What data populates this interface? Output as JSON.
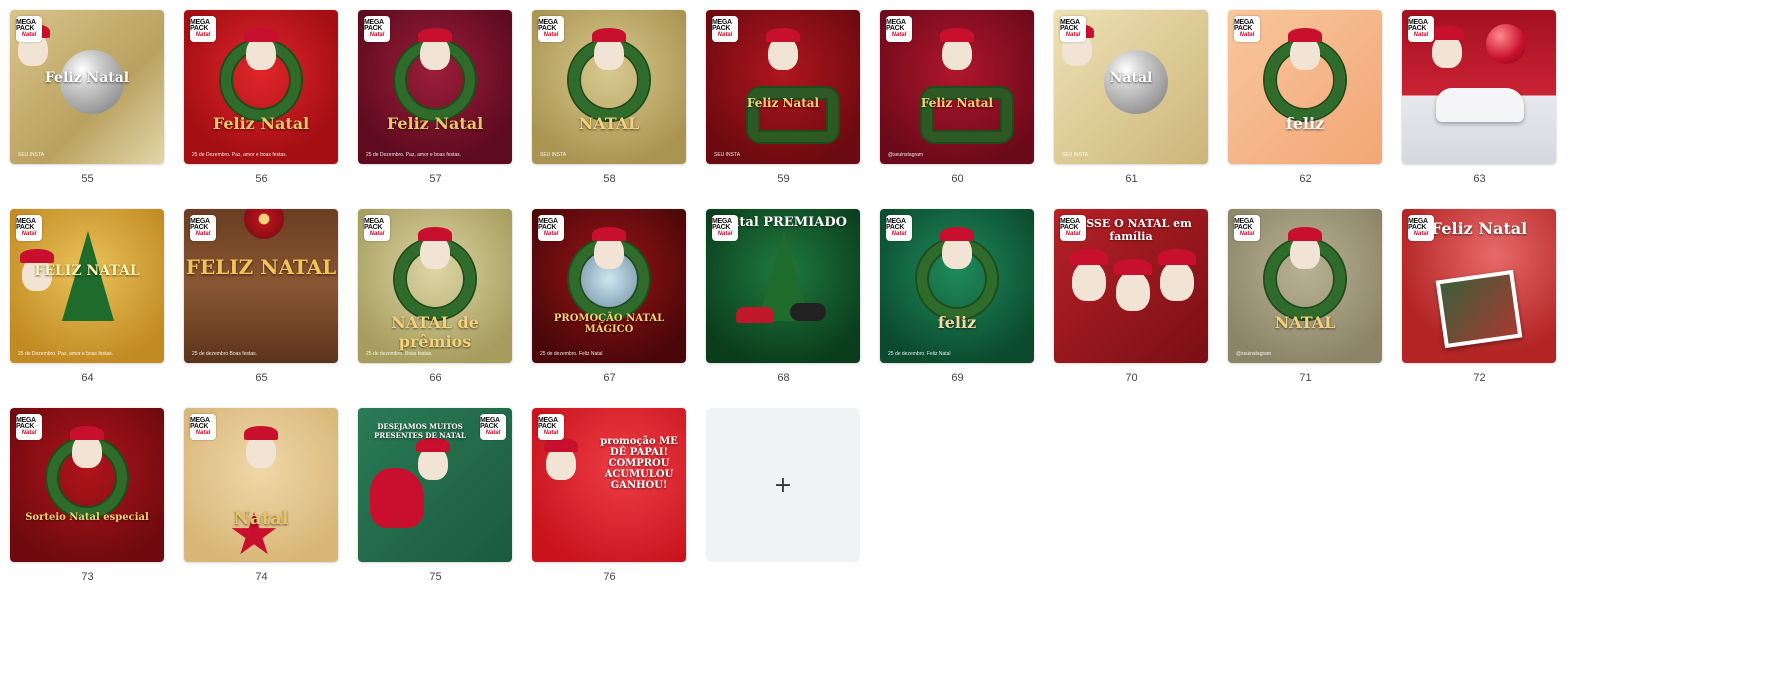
{
  "tiles": [
    {
      "num": "55",
      "bg": "linear-gradient(135deg,#d9c48a,#b9a260 60%,#e3d6a8)",
      "title": "Feliz Natal",
      "titleColor": "#ffffff",
      "caption": "SEU INSTA",
      "motif": "ornament"
    },
    {
      "num": "56",
      "bg": "radial-gradient(circle at 50% 40%,#e0262b,#a50f14 70%)",
      "title": "Feliz Natal",
      "titleColor": "#e8c66a",
      "caption": "25 de Dezembro. Paz, amor e boas festas.",
      "motif": "wreath"
    },
    {
      "num": "57",
      "bg": "radial-gradient(circle at 50% 40%,#9c1d3a,#5e0b1f 75%)",
      "title": "Feliz Natal",
      "titleColor": "#e8c66a",
      "caption": "25 de Dezembro. Paz, amor e boas festas.",
      "motif": "wreath"
    },
    {
      "num": "58",
      "bg": "radial-gradient(circle at 50% 40%,#d8c98f,#a99451 80%)",
      "title": "NATAL",
      "titleColor": "#f3d27a",
      "caption": "SEU INSTA",
      "motif": "wreath"
    },
    {
      "num": "59",
      "bg": "radial-gradient(circle at 50% 40%,#b0161c,#6b0a10 80%)",
      "title": "Feliz Natal",
      "titleColor": "#f1d27b",
      "caption": "SEU INSTA",
      "motif": "frame"
    },
    {
      "num": "60",
      "bg": "radial-gradient(circle at 50% 40%,#b0162c,#6b0a1a 80%)",
      "title": "Feliz Natal",
      "titleColor": "#f1d27b",
      "caption": "@seuinstagram",
      "motif": "frame"
    },
    {
      "num": "61",
      "bg": "linear-gradient(135deg,#efe1b6,#cbb677)",
      "title": "Natal",
      "titleColor": "#ffffff",
      "caption": "SEU INSTA",
      "motif": "ornament"
    },
    {
      "num": "62",
      "bg": "linear-gradient(135deg,#f7c79c,#f3a676)",
      "title": "feliz",
      "titleColor": "#ffffff",
      "caption": "",
      "motif": "wreath"
    },
    {
      "num": "63",
      "bg": "linear-gradient(180deg,#a31021,#c92233 55%,#e8e8ee 56%,#d5d8de)",
      "title": "",
      "titleColor": "#ffffff",
      "caption": "",
      "motif": "car"
    },
    {
      "num": "64",
      "bg": "radial-gradient(circle at 50% 40%,#e9c35a,#c28a22 80%)",
      "title": "FELIZ NATAL",
      "titleColor": "#fff3b0",
      "caption": "25 de Dezembro. Paz, amor e boas festas.",
      "motif": "tree"
    },
    {
      "num": "65",
      "bg": "linear-gradient(180deg,#6a3e22,#8a5632 50%,#5b341c)",
      "title": "FELIZ NATAL",
      "titleColor": "#f4c35a",
      "caption": "25 de dezembro Boas festas.",
      "motif": "wood"
    },
    {
      "num": "66",
      "bg": "radial-gradient(circle at 50% 40%,#ddd6a4,#a59c5d 80%)",
      "title": "NATAL de prêmios",
      "titleColor": "#f3d27a",
      "caption": "25 de dezembro. Boas festas.",
      "motif": "wreath"
    },
    {
      "num": "67",
      "bg": "radial-gradient(circle at 50% 40%,#9a1418,#4a0708 80%)",
      "title": "PROMOÇÃO NATAL MÁGICO",
      "titleColor": "#f3d27a",
      "caption": "25 de dezembro. Feliz Natal",
      "motif": "globe"
    },
    {
      "num": "68",
      "bg": "radial-gradient(circle at 50% 40%,#1f7a3d,#0b3d1d 80%)",
      "title": "Natal PREMIADO",
      "titleColor": "#ffffff",
      "caption": "",
      "motif": "treecar"
    },
    {
      "num": "69",
      "bg": "radial-gradient(circle at 50% 40%,#1f8a5a,#0b4a2d 80%)",
      "title": "feliz",
      "titleColor": "#f6d8a2",
      "caption": "25 de dezembro. Feliz Natal",
      "motif": "wreath"
    },
    {
      "num": "70",
      "bg": "linear-gradient(135deg,#b52127,#7a0f14)",
      "title": "PASSE O NATAL em família",
      "titleColor": "#ffffff",
      "caption": "",
      "motif": "family"
    },
    {
      "num": "71",
      "bg": "radial-gradient(circle at 50% 40%,#b8b295,#8c8466 80%)",
      "title": "NATAL",
      "titleColor": "#f3d27a",
      "caption": "@seuinstagram",
      "motif": "wreath"
    },
    {
      "num": "72",
      "bg": "radial-gradient(circle at 60% 30%,#e76a6a,#b32424 70%)",
      "title": "Feliz Natal",
      "titleColor": "#ffffff",
      "caption": "",
      "motif": "photo"
    },
    {
      "num": "73",
      "bg": "radial-gradient(circle at 50% 40%,#b0141a,#6e0a0f 80%)",
      "title": "Sorteio Natal especial",
      "titleColor": "#f3d27a",
      "caption": "",
      "motif": "wreath"
    },
    {
      "num": "74",
      "bg": "radial-gradient(circle at 50% 40%,#f0d8a8,#d8b678 80%)",
      "title": "Natal",
      "titleColor": "#e7c46a",
      "caption": "",
      "motif": "star"
    },
    {
      "num": "75",
      "bg": "linear-gradient(135deg,#2a7b55,#1b5a3e)",
      "title": "DESEJAMOS MUITOS PRESENTES DE NATAL",
      "titleColor": "#ffffff",
      "caption": "",
      "motif": "santabag"
    },
    {
      "num": "76",
      "bg": "radial-gradient(circle at 60% 40%,#ef3d45,#c9141e 80%)",
      "title": "promoção ME DÊ PAPAI! COMPROU ACUMULOU GANHOU!",
      "titleColor": "#ffffff",
      "caption": "",
      "motif": "santa"
    }
  ],
  "tile_texts": {
    "55": {
      "l1": "Feliz",
      "l2": "Natal"
    },
    "63": {
      "l1": "",
      "l2": ""
    },
    "70": {
      "l1": "PASSE O NATAL",
      "l2": "em família"
    },
    "72": {
      "l1": "Feliz",
      "l2": "Natal"
    },
    "76": {
      "l1": "promoção",
      "l2": "ME DÊ PAPAI!",
      "l3": "COMPROU ACUMULOU GANHOU!"
    }
  },
  "badge": {
    "line1": "MEGA PACK",
    "line2": "Natal"
  },
  "add_tile": {
    "label": "+"
  }
}
